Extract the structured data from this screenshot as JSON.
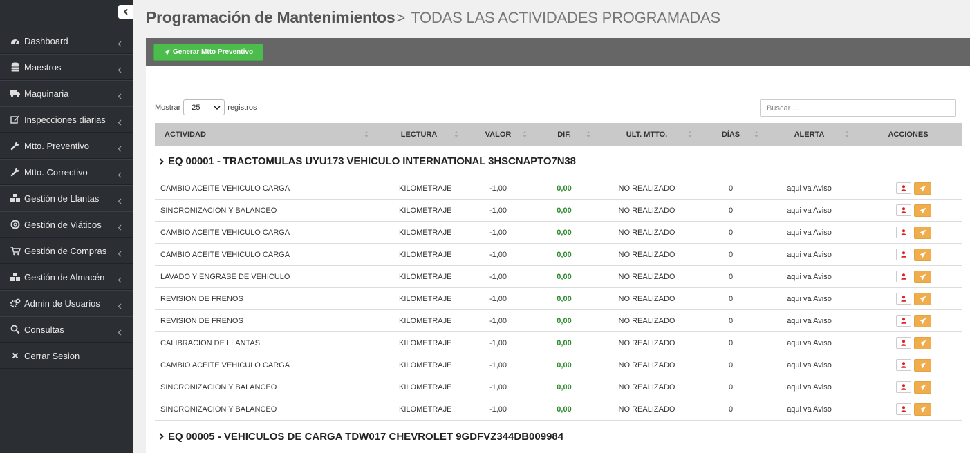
{
  "sidebar": {
    "items": [
      {
        "label": "Dashboard",
        "icon": "dashboard-icon"
      },
      {
        "label": "Maestros",
        "icon": "database-icon"
      },
      {
        "label": "Maquinaria",
        "icon": "truck-icon"
      },
      {
        "label": "Inspecciones diarias",
        "icon": "edit-icon"
      },
      {
        "label": "Mtto. Preventivo",
        "icon": "wrench-icon"
      },
      {
        "label": "Mtto. Correctivo",
        "icon": "wrench-icon"
      },
      {
        "label": "Gestión de Llantas",
        "icon": "cubes-icon"
      },
      {
        "label": "Gestión de Viáticos",
        "icon": "life-ring-icon"
      },
      {
        "label": "Gestión de Compras",
        "icon": "cart-icon"
      },
      {
        "label": "Gestión de Almacén",
        "icon": "cubes-icon"
      },
      {
        "label": "Admin de Usuarios",
        "icon": "cogs-icon"
      },
      {
        "label": "Consultas",
        "icon": "search-icon"
      },
      {
        "label": "Cerrar Sesion",
        "icon": "close-icon"
      }
    ]
  },
  "header": {
    "title": "Programación de Mantenimientos",
    "separator": ">",
    "subtitle": "TODAS LAS ACTIVIDADES PROGRAMADAS"
  },
  "toolbar": {
    "generate_label": "Generar Mtto Preventivo"
  },
  "length": {
    "before": "Mostrar",
    "value": "25",
    "after": "registros"
  },
  "search": {
    "placeholder": "Buscar ..."
  },
  "table": {
    "columns": [
      "ACTIVIDAD",
      "LECTURA",
      "VALOR",
      "DIF.",
      "ULT. MTTO.",
      "DÍAS",
      "ALERTA",
      "ACCIONES"
    ],
    "groups": [
      {
        "title": "EQ 00001 - TRACTOMULAS UYU173 VEHICULO INTERNATIONAL 3HSCNAPTO7N38",
        "rows": [
          {
            "actividad": "CAMBIO ACEITE VEHICULO CARGA",
            "lectura": "KILOMETRAJE",
            "valor": "-1,00",
            "dif": "0,00",
            "ult": "NO REALIZADO",
            "dias": "0",
            "alerta": "aqui va Aviso"
          },
          {
            "actividad": "SINCRONIZACION Y BALANCEO",
            "lectura": "KILOMETRAJE",
            "valor": "-1,00",
            "dif": "0,00",
            "ult": "NO REALIZADO",
            "dias": "0",
            "alerta": "aqui va Aviso"
          },
          {
            "actividad": "CAMBIO ACEITE VEHICULO CARGA",
            "lectura": "KILOMETRAJE",
            "valor": "-1,00",
            "dif": "0,00",
            "ult": "NO REALIZADO",
            "dias": "0",
            "alerta": "aqui va Aviso"
          },
          {
            "actividad": "CAMBIO ACEITE VEHICULO CARGA",
            "lectura": "KILOMETRAJE",
            "valor": "-1,00",
            "dif": "0,00",
            "ult": "NO REALIZADO",
            "dias": "0",
            "alerta": "aqui va Aviso"
          },
          {
            "actividad": "LAVADO Y ENGRASE DE VEHICULO",
            "lectura": "KILOMETRAJE",
            "valor": "-1,00",
            "dif": "0,00",
            "ult": "NO REALIZADO",
            "dias": "0",
            "alerta": "aqui va Aviso"
          },
          {
            "actividad": "REVISION DE FRENOS",
            "lectura": "KILOMETRAJE",
            "valor": "-1,00",
            "dif": "0,00",
            "ult": "NO REALIZADO",
            "dias": "0",
            "alerta": "aqui va Aviso"
          },
          {
            "actividad": "REVISION DE FRENOS",
            "lectura": "KILOMETRAJE",
            "valor": "-1,00",
            "dif": "0,00",
            "ult": "NO REALIZADO",
            "dias": "0",
            "alerta": "aqui va Aviso"
          },
          {
            "actividad": "CALIBRACION DE LLANTAS",
            "lectura": "KILOMETRAJE",
            "valor": "-1,00",
            "dif": "0,00",
            "ult": "NO REALIZADO",
            "dias": "0",
            "alerta": "aqui va Aviso"
          },
          {
            "actividad": "CAMBIO ACEITE VEHICULO CARGA",
            "lectura": "KILOMETRAJE",
            "valor": "-1,00",
            "dif": "0,00",
            "ult": "NO REALIZADO",
            "dias": "0",
            "alerta": "aqui va Aviso"
          },
          {
            "actividad": "SINCRONIZACION Y BALANCEO",
            "lectura": "KILOMETRAJE",
            "valor": "-1,00",
            "dif": "0,00",
            "ult": "NO REALIZADO",
            "dias": "0",
            "alerta": "aqui va Aviso"
          },
          {
            "actividad": "SINCRONIZACION Y BALANCEO",
            "lectura": "KILOMETRAJE",
            "valor": "-1,00",
            "dif": "0,00",
            "ult": "NO REALIZADO",
            "dias": "0",
            "alerta": "aqui va Aviso"
          }
        ]
      },
      {
        "title": "EQ 00005 - VEHICULOS DE CARGA TDW017 CHEVROLET 9GDFVZ344DB009984",
        "rows": []
      }
    ]
  },
  "colors": {
    "sidebar_bg": "#2b2f33",
    "toolbar_bg": "#666666",
    "success": "#4cbc4c",
    "warning": "#f0ad4e",
    "danger": "#e02020",
    "dif_green": "#2b8a2b"
  }
}
